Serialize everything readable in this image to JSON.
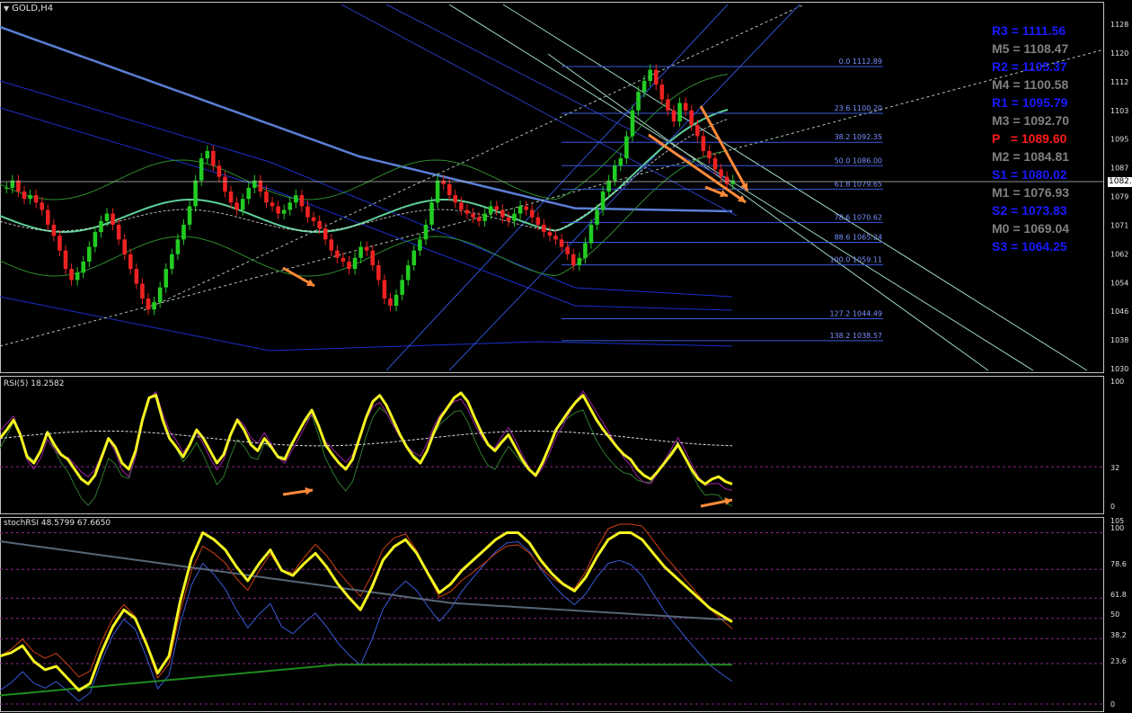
{
  "window": {
    "symbol_label": "GOLD,H4",
    "current_price_label": "1082."
  },
  "price_axis": {
    "ticks": [
      "1128",
      "1120",
      "1112",
      "1103",
      "1095",
      "1087",
      "1079",
      "1071",
      "1062",
      "1054",
      "1046",
      "1038",
      "1030"
    ]
  },
  "pivots": [
    {
      "label": "R3 = 1111.56",
      "color": "#1a1aff"
    },
    {
      "label": "M5 = 1108.47",
      "color": "#808080"
    },
    {
      "label": "R2 = 1105.37",
      "color": "#1a1aff"
    },
    {
      "label": "M4 = 1100.58",
      "color": "#808080"
    },
    {
      "label": "R1 = 1095.79",
      "color": "#1a1aff"
    },
    {
      "label": "M3 = 1092.70",
      "color": "#808080"
    },
    {
      "label": "P   = 1089.60",
      "color": "#ff1a1a"
    },
    {
      "label": "M2 = 1084.81",
      "color": "#808080"
    },
    {
      "label": "S1 = 1080.02",
      "color": "#1a1aff"
    },
    {
      "label": "M1 = 1076.93",
      "color": "#808080"
    },
    {
      "label": "S2 = 1073.83",
      "color": "#1a1aff"
    },
    {
      "label": "M0 = 1069.04",
      "color": "#808080"
    },
    {
      "label": "S3 = 1064.25",
      "color": "#1a1aff"
    }
  ],
  "fibonacci": [
    {
      "label": "0.0  1112.89",
      "price": 1112.89
    },
    {
      "label": "23.6  1100.20",
      "price": 1100.2
    },
    {
      "label": "38.2  1092.35",
      "price": 1092.35
    },
    {
      "label": "50.0  1086.00",
      "price": 1086.0
    },
    {
      "label": "61.8  1079.65",
      "price": 1079.65
    },
    {
      "label": "78.6  1070.62",
      "price": 1070.62
    },
    {
      "label": "88.6  1065.24",
      "price": 1065.24
    },
    {
      "label": "100.0  1059.11",
      "price": 1059.11
    },
    {
      "label": "127.2  1044.49",
      "price": 1044.49
    },
    {
      "label": "138.2  1038.57",
      "price": 1038.57
    }
  ],
  "rsi": {
    "title": "RSI(5) 18.2582",
    "ticks": [
      "100",
      "32",
      "0"
    ]
  },
  "stoch": {
    "title": "stochRSI 48.5799 67.6650",
    "ticks": [
      "105",
      "100",
      "78.6",
      "61.8",
      "50",
      "38.2",
      "23.6",
      "0"
    ]
  },
  "chart_data": [
    {
      "type": "candlestick",
      "title": "GOLD,H4",
      "ylim": [
        1030,
        1128
      ],
      "close": [
        1080,
        1082,
        1079,
        1077,
        1078,
        1076,
        1074,
        1070,
        1067,
        1063,
        1058,
        1055,
        1057,
        1060,
        1064,
        1068,
        1071,
        1073,
        1070,
        1066,
        1062,
        1058,
        1054,
        1050,
        1047,
        1049,
        1053,
        1058,
        1062,
        1066,
        1070,
        1075,
        1082,
        1088,
        1090,
        1086,
        1083,
        1079,
        1076,
        1074,
        1077,
        1080,
        1082,
        1079,
        1076,
        1075,
        1073,
        1074,
        1076,
        1078,
        1075,
        1072,
        1071,
        1069,
        1066,
        1063,
        1061,
        1060,
        1058,
        1061,
        1064,
        1063,
        1059,
        1055,
        1050,
        1048,
        1051,
        1055,
        1059,
        1063,
        1066,
        1070,
        1076,
        1082,
        1081,
        1078,
        1076,
        1074,
        1073,
        1072,
        1071,
        1073,
        1075,
        1074,
        1072,
        1071,
        1073,
        1075,
        1074,
        1072,
        1070,
        1068,
        1067,
        1066,
        1064,
        1062,
        1059,
        1061,
        1065,
        1070,
        1074,
        1079,
        1082,
        1086,
        1088,
        1094,
        1101,
        1106,
        1109,
        1112,
        1108,
        1104,
        1101,
        1098,
        1103,
        1101,
        1097,
        1094,
        1090,
        1088,
        1085,
        1083,
        1081,
        1082
      ],
      "rsi": [
        55,
        62,
        70,
        58,
        40,
        35,
        45,
        60,
        50,
        42,
        38,
        30,
        22,
        18,
        25,
        40,
        55,
        48,
        35,
        30,
        45,
        70,
        88,
        90,
        70,
        55,
        48,
        40,
        50,
        62,
        55,
        45,
        35,
        42,
        58,
        70,
        62,
        50,
        45,
        55,
        48,
        40,
        38,
        50,
        60,
        70,
        78,
        65,
        50,
        42,
        35,
        30,
        38,
        55,
        72,
        85,
        90,
        82,
        70,
        58,
        48,
        40,
        35,
        45,
        60,
        72,
        80,
        88,
        92,
        85,
        72,
        60,
        50,
        45,
        52,
        58,
        48,
        38,
        30,
        25,
        35,
        48,
        62,
        70,
        78,
        85,
        90,
        80,
        70,
        62,
        55,
        48,
        42,
        38,
        30,
        25,
        22,
        28,
        35,
        42,
        50,
        40,
        30,
        22,
        18,
        22,
        24,
        20,
        18
      ],
      "stoch_k": [
        28,
        30,
        34,
        25,
        20,
        22,
        15,
        8,
        12,
        30,
        45,
        55,
        50,
        35,
        18,
        28,
        60,
        85,
        100,
        96,
        90,
        80,
        72,
        82,
        90,
        78,
        75,
        82,
        88,
        80,
        70,
        62,
        55,
        68,
        84,
        92,
        96,
        88,
        76,
        65,
        70,
        78,
        84,
        90,
        96,
        100,
        100,
        94,
        84,
        76,
        70,
        66,
        74,
        86,
        96,
        100,
        100,
        96,
        88,
        80,
        74,
        68,
        62,
        56,
        52,
        48
      ]
    }
  ]
}
